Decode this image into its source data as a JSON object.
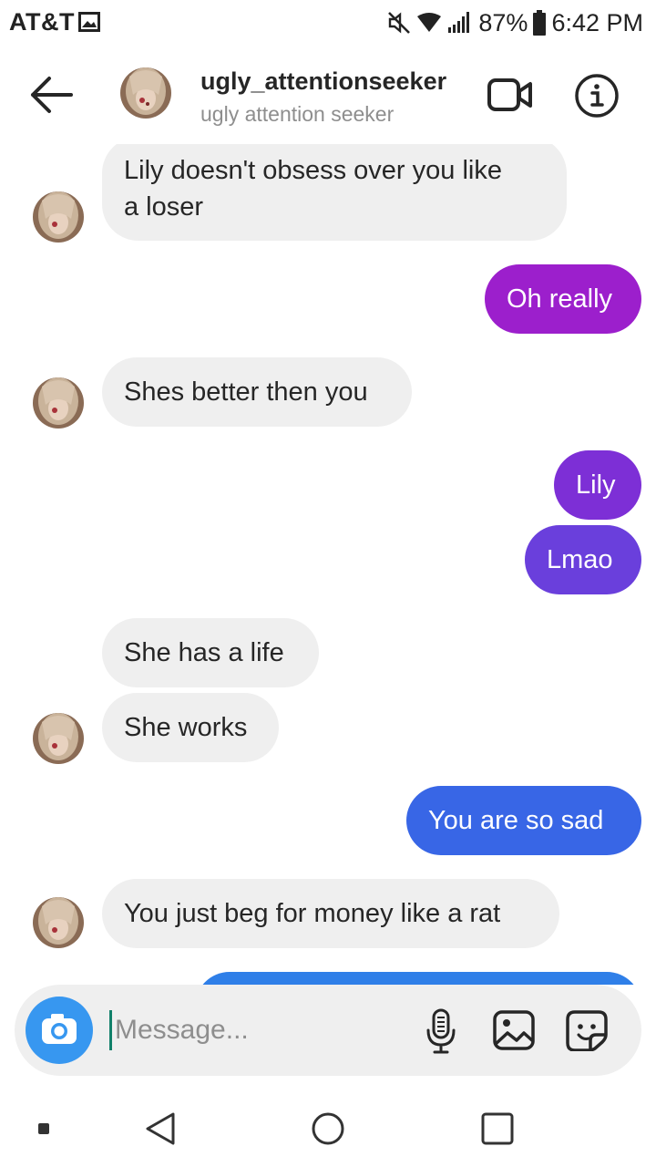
{
  "status_bar": {
    "carrier": "AT&T",
    "battery": "87%",
    "time": "6:42 PM",
    "icons": [
      "gallery-icon",
      "mute-icon",
      "wifi-icon",
      "signal-icon",
      "battery-icon"
    ]
  },
  "header": {
    "username": "ugly_attentionseeker",
    "full_name": "ugly attention seeker",
    "icons": [
      "back-arrow-icon",
      "video-call-icon",
      "info-icon"
    ]
  },
  "messages": [
    {
      "direction": "incoming",
      "lines": [
        "Lily doesn't obsess over you like",
        "a loser"
      ]
    },
    {
      "direction": "outgoing",
      "lines": [
        "Oh really"
      ],
      "color": "#9c1fcc"
    },
    {
      "direction": "incoming",
      "lines": [
        "Shes better then you"
      ]
    },
    {
      "direction": "outgoing",
      "lines": [
        "Lily"
      ],
      "color": "#7d2fd6"
    },
    {
      "direction": "outgoing",
      "lines": [
        "Lmao"
      ],
      "color": "#6a3fdc"
    },
    {
      "direction": "incoming",
      "lines": [
        "She has a life"
      ]
    },
    {
      "direction": "incoming",
      "lines": [
        "She works"
      ]
    },
    {
      "direction": "outgoing",
      "lines": [
        "You are so sad"
      ],
      "color": "#3866e6"
    },
    {
      "direction": "incoming",
      "lines": [
        "You just beg for money like a rat"
      ]
    }
  ],
  "composer": {
    "placeholder": "Message...",
    "icons": [
      "camera-icon",
      "microphone-icon",
      "gallery-icon",
      "sticker-icon"
    ]
  },
  "nav_bar": {
    "icons": [
      "nav-dot-icon",
      "nav-back-icon",
      "nav-home-icon",
      "nav-recent-apps-icon"
    ]
  },
  "colors": {
    "incoming_bubble": "#efefef",
    "camera_button": "#3797f0",
    "partial_bubble": "#2f7fe8"
  }
}
